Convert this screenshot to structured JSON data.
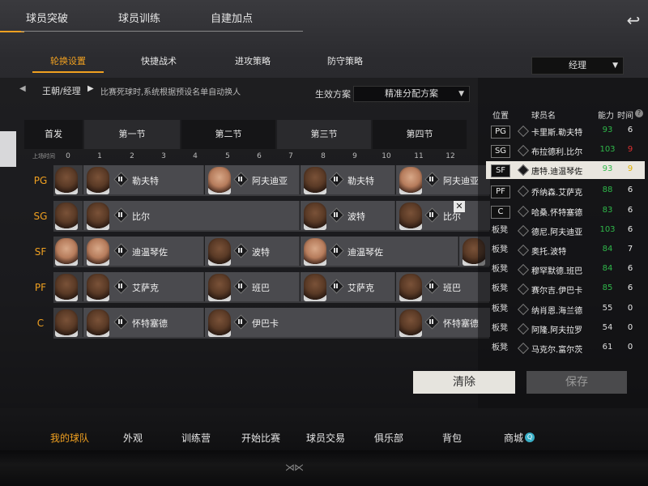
{
  "top_tabs": [
    "球员突破",
    "球员训练",
    "自建加点"
  ],
  "sub_tabs": [
    "轮换设置",
    "快捷战术",
    "进攻策略",
    "防守策略"
  ],
  "role_select": "经理",
  "breadcrumb": "王朝/经理",
  "hint": "比赛死球时,系统根据预设名单自动换人",
  "effect": {
    "label": "生效方案",
    "value": "精准分配方案"
  },
  "grid_headers": [
    "首发",
    "第一节",
    "第二节",
    "第三节",
    "第四节"
  ],
  "tick_label": "上场时间",
  "ticks": [
    "0",
    "1",
    "2",
    "3",
    "4",
    "5",
    "6",
    "7",
    "8",
    "9",
    "10",
    "11",
    "12"
  ],
  "rows": [
    {
      "pos": "PG",
      "names": [
        "勒夫特",
        "阿夫迪亚",
        "勒夫特",
        "阿夫迪亚"
      ]
    },
    {
      "pos": "SG",
      "names": [
        "比尔",
        "波特",
        "比尔"
      ]
    },
    {
      "pos": "SF",
      "names": [
        "迪温琴佐",
        "波特",
        "迪温琴佐"
      ]
    },
    {
      "pos": "PF",
      "names": [
        "艾萨克",
        "班巴",
        "艾萨克",
        "班巴"
      ]
    },
    {
      "pos": "C",
      "names": [
        "怀特塞德",
        "伊巴卡",
        "怀特塞德"
      ]
    }
  ],
  "roster_headers": {
    "pos": "位置",
    "name": "球员名",
    "rating": "能力",
    "time": "时间"
  },
  "roster": [
    {
      "pos": "PG",
      "name": "卡里斯.勒夫特",
      "rating": "93",
      "time": "6"
    },
    {
      "pos": "SG",
      "name": "布拉德利.比尔",
      "rating": "103",
      "time": "9"
    },
    {
      "pos": "SF",
      "name": "唐特.迪温琴佐",
      "rating": "93",
      "time": "9"
    },
    {
      "pos": "PF",
      "name": "乔纳森.艾萨克",
      "rating": "88",
      "time": "6"
    },
    {
      "pos": "C",
      "name": "哈桑.怀特塞德",
      "rating": "83",
      "time": "6"
    },
    {
      "pos": "板凳",
      "name": "德尼.阿夫迪亚",
      "rating": "103",
      "time": "6"
    },
    {
      "pos": "板凳",
      "name": "奥托.波特",
      "rating": "84",
      "time": "7"
    },
    {
      "pos": "板凳",
      "name": "穆罕默德.班巴",
      "rating": "84",
      "time": "6"
    },
    {
      "pos": "板凳",
      "name": "赛尔吉.伊巴卡",
      "rating": "85",
      "time": "6"
    },
    {
      "pos": "板凳",
      "name": "纳肖恩.海兰德",
      "rating": "55",
      "time": "0"
    },
    {
      "pos": "板凳",
      "name": "阿隆.阿夫拉罗",
      "rating": "54",
      "time": "0"
    },
    {
      "pos": "板凳",
      "name": "马克尔.富尔茨",
      "rating": "61",
      "time": "0"
    }
  ],
  "buttons": {
    "clear": "清除",
    "save": "保存"
  },
  "bottom_nav": [
    "我的球队",
    "外观",
    "训练营",
    "开始比赛",
    "球员交易",
    "俱乐部",
    "背包",
    "商城"
  ],
  "colors": {
    "accent": "#f0a020",
    "green": "#2fb84a",
    "red": "#e03030",
    "yellow": "#e0b000"
  }
}
